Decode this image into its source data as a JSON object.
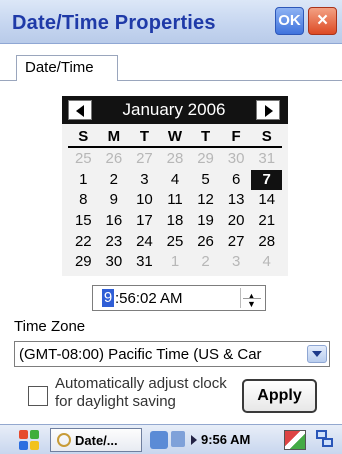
{
  "window": {
    "title": "Date/Time Properties",
    "ok_label": "OK",
    "close_label": "×"
  },
  "tabs": [
    {
      "label": "Date/Time",
      "active": true
    }
  ],
  "calendar": {
    "month_label": "January 2006",
    "prev_icon": "triangle-left-icon",
    "next_icon": "triangle-right-icon",
    "weekdays": [
      "S",
      "M",
      "T",
      "W",
      "T",
      "F",
      "S"
    ],
    "weeks": [
      [
        "25",
        "26",
        "27",
        "28",
        "29",
        "30",
        "31"
      ],
      [
        "1",
        "2",
        "3",
        "4",
        "5",
        "6",
        "7"
      ],
      [
        "8",
        "9",
        "10",
        "11",
        "12",
        "13",
        "14"
      ],
      [
        "15",
        "16",
        "17",
        "18",
        "19",
        "20",
        "21"
      ],
      [
        "22",
        "23",
        "24",
        "25",
        "26",
        "27",
        "28"
      ],
      [
        "29",
        "30",
        "31",
        "1",
        "2",
        "3",
        "4"
      ]
    ],
    "selected_day": "7"
  },
  "time": {
    "hour": "9",
    "rest": ":56:02 AM"
  },
  "timezone": {
    "label": "Time Zone",
    "value": "(GMT-08:00) Pacific Time (US & Car"
  },
  "auto_adjust": {
    "label": "Automatically adjust clock for daylight saving",
    "checked": false
  },
  "apply_label": "Apply",
  "taskbar": {
    "task_label": "Date/...",
    "clock": "9:56 AM"
  },
  "colors": {
    "title_text": "#1f3aa8",
    "selection": "#2f5ed6",
    "calendar_header": "#121212"
  }
}
